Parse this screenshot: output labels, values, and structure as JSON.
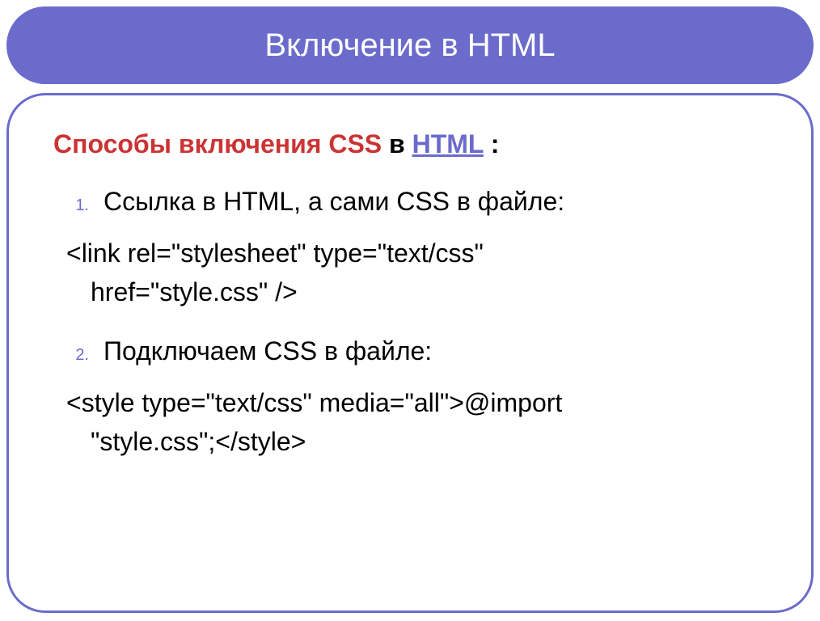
{
  "title": "Включение в HTML",
  "heading": {
    "part1_red": "Способы включения CSS",
    "part2_black": " в ",
    "part3_link": "HTML",
    "part4_black": " :"
  },
  "item1": {
    "number": "1.",
    "text": "Ссылка в HTML, а сами CSS в файле:"
  },
  "code1": {
    "line1": "<link rel=\"stylesheet\" type=\"text/css\"",
    "line2": "href=\"style.css\" />"
  },
  "item2": {
    "number": "2.",
    "text": "Подключаем CSS в файле:"
  },
  "code2": {
    "line1": "<style type=\"text/css\" media=\"all\">@import",
    "line2": "\"style.css\";</style>"
  }
}
